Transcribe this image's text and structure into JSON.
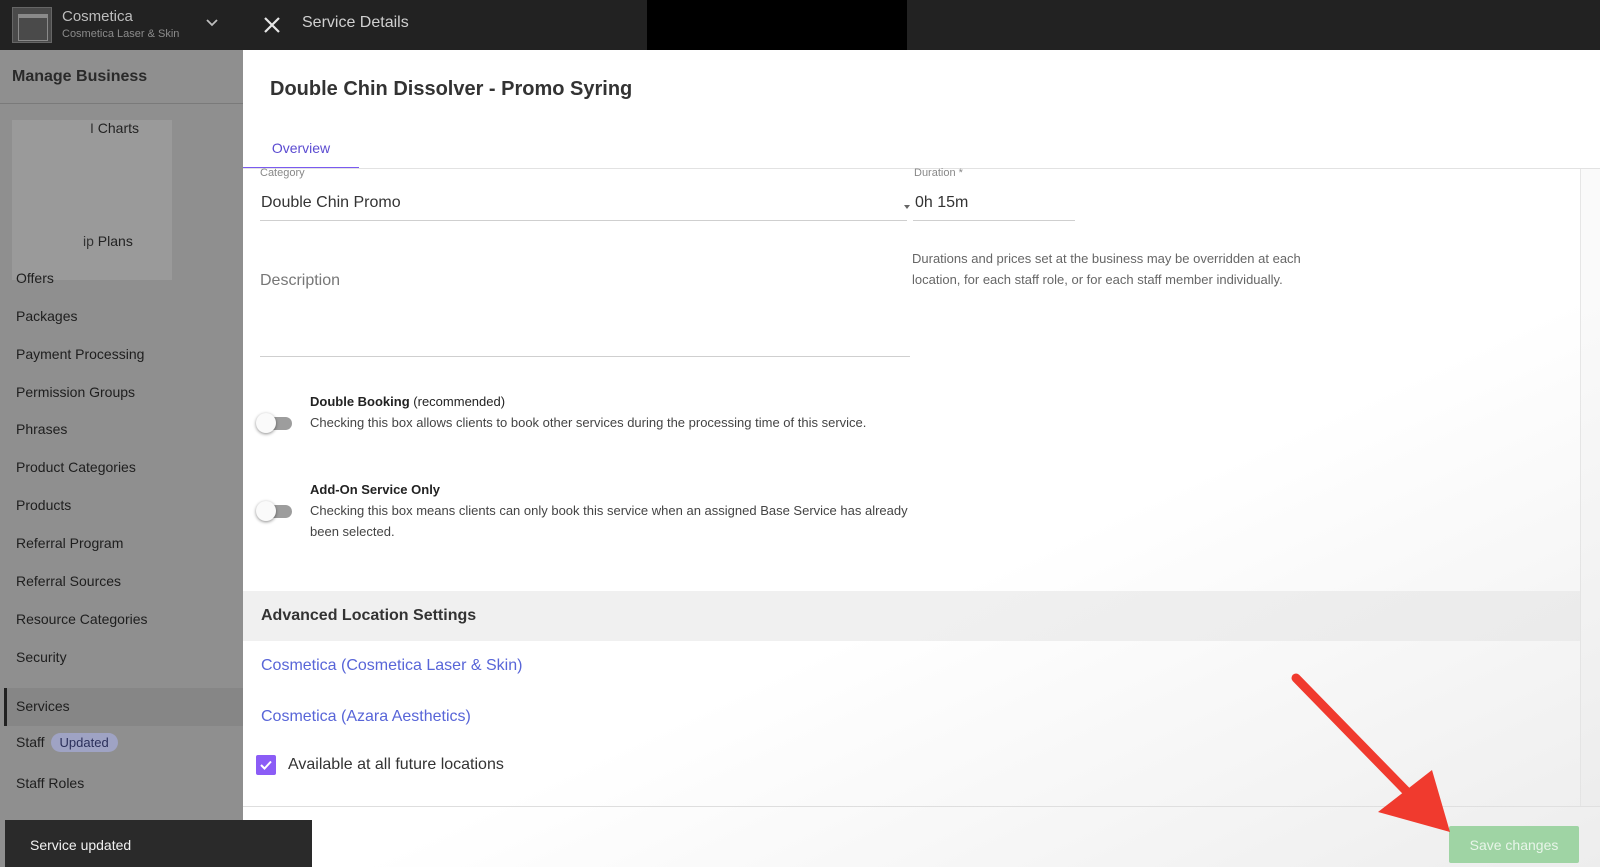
{
  "topbar": {
    "brand_name": "Cosmetica",
    "brand_subtitle": "Cosmetica Laser & Skin",
    "title": "Service Details"
  },
  "sidebar": {
    "header": "Manage Business",
    "partial_items": [
      "Charts",
      "Plans"
    ],
    "items": [
      {
        "label": "Offers"
      },
      {
        "label": "Packages"
      },
      {
        "label": "Payment Processing"
      },
      {
        "label": "Permission Groups"
      },
      {
        "label": "Phrases"
      },
      {
        "label": "Product Categories"
      },
      {
        "label": "Products"
      },
      {
        "label": "Referral Program"
      },
      {
        "label": "Referral Sources"
      },
      {
        "label": "Resource Categories"
      },
      {
        "label": "Security"
      },
      {
        "label": "Services"
      },
      {
        "label": "Staff",
        "badge": "Updated"
      },
      {
        "label": "Staff Roles"
      }
    ],
    "active": "Services"
  },
  "service": {
    "name": "Double Chin Dissolver - Promo Syring",
    "tab_overview": "Overview",
    "category_label": "Category",
    "category_value": "Double Chin Promo",
    "duration_label": "Duration *",
    "duration_value": "0h 15m",
    "description_placeholder": "Description",
    "pricing_note": "Durations and prices set at the business may be overridden at each location, for each staff role, or for each staff member individually."
  },
  "options": {
    "double_booking_title": "Double Booking",
    "double_booking_hint": "(recommended)",
    "double_booking_desc": "Checking this box allows clients to book other services during the processing time of this service.",
    "double_booking_enabled": false,
    "addon_title": "Add-On Service Only",
    "addon_desc": "Checking this box means clients can only book this service when an assigned Base Service has already been selected.",
    "addon_enabled": false
  },
  "advanced": {
    "title": "Advanced Location Settings",
    "locations": [
      "Cosmetica (Cosmetica Laser & Skin)",
      "Cosmetica (Azara Aesthetics)"
    ],
    "future_locations_label": "Available at all future locations",
    "future_locations_checked": true
  },
  "footer": {
    "save_label": "Save changes"
  },
  "toast": {
    "message": "Service updated"
  },
  "colors": {
    "accent": "#8b5cf6",
    "link": "#5865d8",
    "save_button": "#9fd4a4",
    "annotation_arrow": "#f03a2e"
  }
}
